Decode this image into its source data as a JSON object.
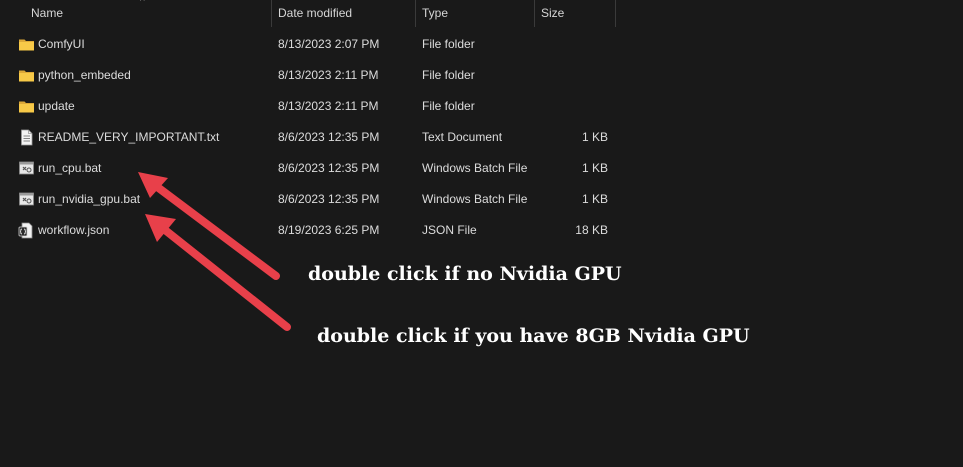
{
  "columns": {
    "name": "Name",
    "date_modified": "Date modified",
    "type": "Type",
    "size": "Size"
  },
  "sort_indicator": "^",
  "files": [
    {
      "icon": "folder-icon",
      "name": "ComfyUI",
      "date": "8/13/2023 2:07 PM",
      "type": "File folder",
      "size": ""
    },
    {
      "icon": "folder-icon",
      "name": "python_embeded",
      "date": "8/13/2023 2:11 PM",
      "type": "File folder",
      "size": ""
    },
    {
      "icon": "folder-icon",
      "name": "update",
      "date": "8/13/2023 2:11 PM",
      "type": "File folder",
      "size": ""
    },
    {
      "icon": "text-document-icon",
      "name": "README_VERY_IMPORTANT.txt",
      "date": "8/6/2023 12:35 PM",
      "type": "Text Document",
      "size": "1 KB"
    },
    {
      "icon": "batch-file-icon",
      "name": "run_cpu.bat",
      "date": "8/6/2023 12:35 PM",
      "type": "Windows Batch File",
      "size": "1 KB"
    },
    {
      "icon": "batch-file-icon",
      "name": "run_nvidia_gpu.bat",
      "date": "8/6/2023 12:35 PM",
      "type": "Windows Batch File",
      "size": "1 KB"
    },
    {
      "icon": "json-file-icon",
      "name": "workflow.json",
      "date": "8/19/2023 6:25 PM",
      "type": "JSON File",
      "size": "18 KB"
    }
  ],
  "annotations": {
    "no_gpu": "double click if no Nvidia GPU",
    "gpu": "double click if you have 8GB Nvidia GPU"
  },
  "colors": {
    "background": "#191919",
    "folder": "#f5c84c",
    "arrow": "#e8404a",
    "text": "#dcdcdc"
  }
}
